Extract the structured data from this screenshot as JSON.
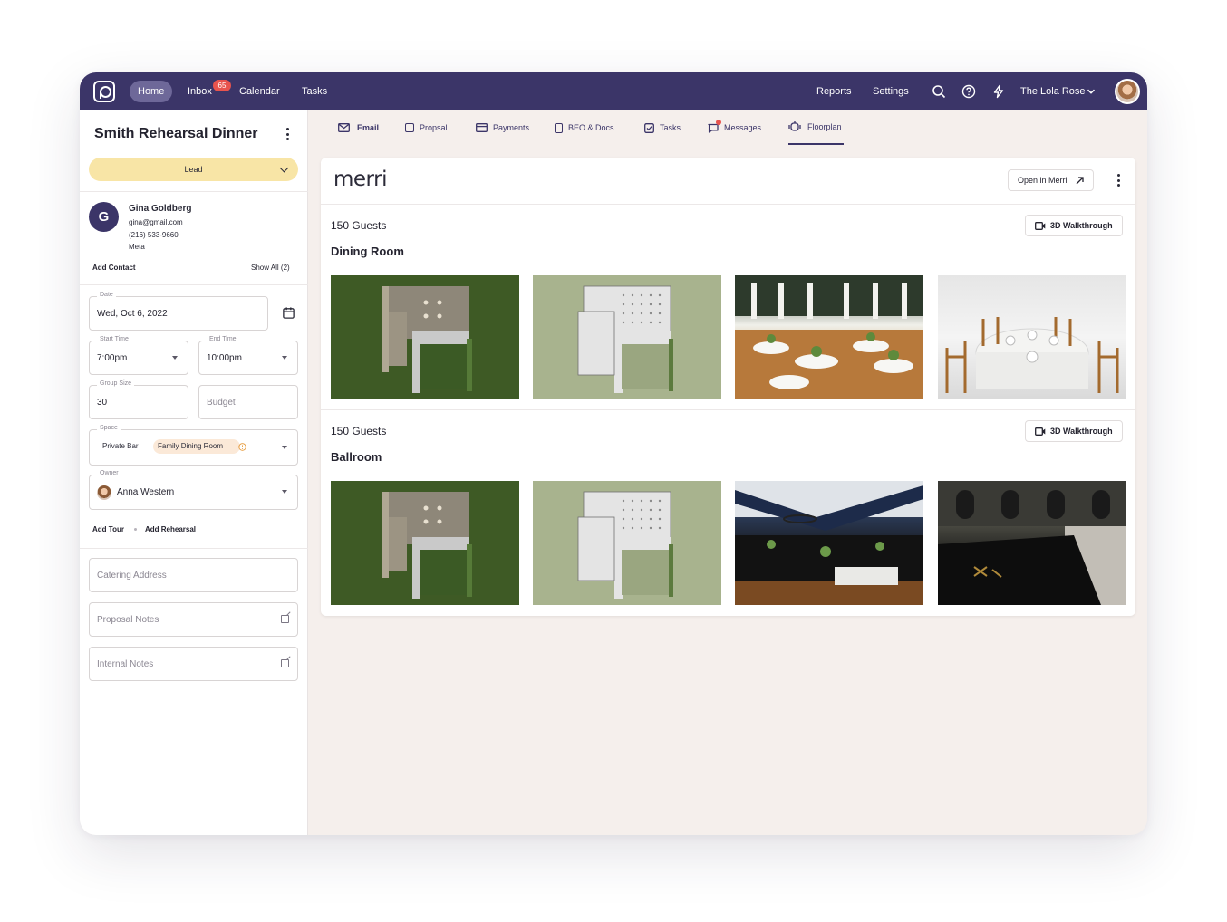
{
  "topbar": {
    "nav": {
      "home": "Home",
      "inbox": "Inbox",
      "inbox_count": "65",
      "calendar": "Calendar",
      "tasks": "Tasks"
    },
    "right": {
      "reports": "Reports",
      "settings": "Settings",
      "venue": "The Lola Rose"
    }
  },
  "event": {
    "title": "Smith Rehearsal Dinner",
    "status": "Lead",
    "contact": {
      "initial": "G",
      "name": "Gina Goldberg",
      "email": "gina@gmail.com",
      "phone": "(216) 533-9660",
      "source": "Meta"
    },
    "add_contact": "Add Contact",
    "show_all": "Show All (2)",
    "date_label": "Date",
    "date_value": "Wed, Oct 6, 2022",
    "start_label": "Start Time",
    "start_value": "7:00pm",
    "end_label": "End Time",
    "end_value": "10:00pm",
    "group_label": "Group Size",
    "group_value": "30",
    "budget_placeholder": "Budget",
    "space_label": "Space",
    "space_chips": [
      "Private Bar",
      "Family Dining Room"
    ],
    "owner_label": "Owner",
    "owner_value": "Anna Western",
    "add_tour": "Add Tour",
    "add_rehearsal": "Add Rehearsal",
    "catering_placeholder": "Catering Address",
    "proposal_placeholder": "Proposal Notes",
    "internal_placeholder": "Internal Notes"
  },
  "tabs": [
    "Email",
    "Propsal",
    "Payments",
    "BEO & Docs",
    "Tasks",
    "Messages",
    "Floorplan"
  ],
  "tabs_active": "Floorplan",
  "floorplan": {
    "brand": "merri",
    "open_button": "Open in Merri",
    "walkthrough_label": "3D Walkthrough",
    "rooms": [
      {
        "guests": "150 Guests",
        "name": "Dining Room"
      },
      {
        "guests": "150 Guests",
        "name": "Ballroom"
      }
    ]
  }
}
